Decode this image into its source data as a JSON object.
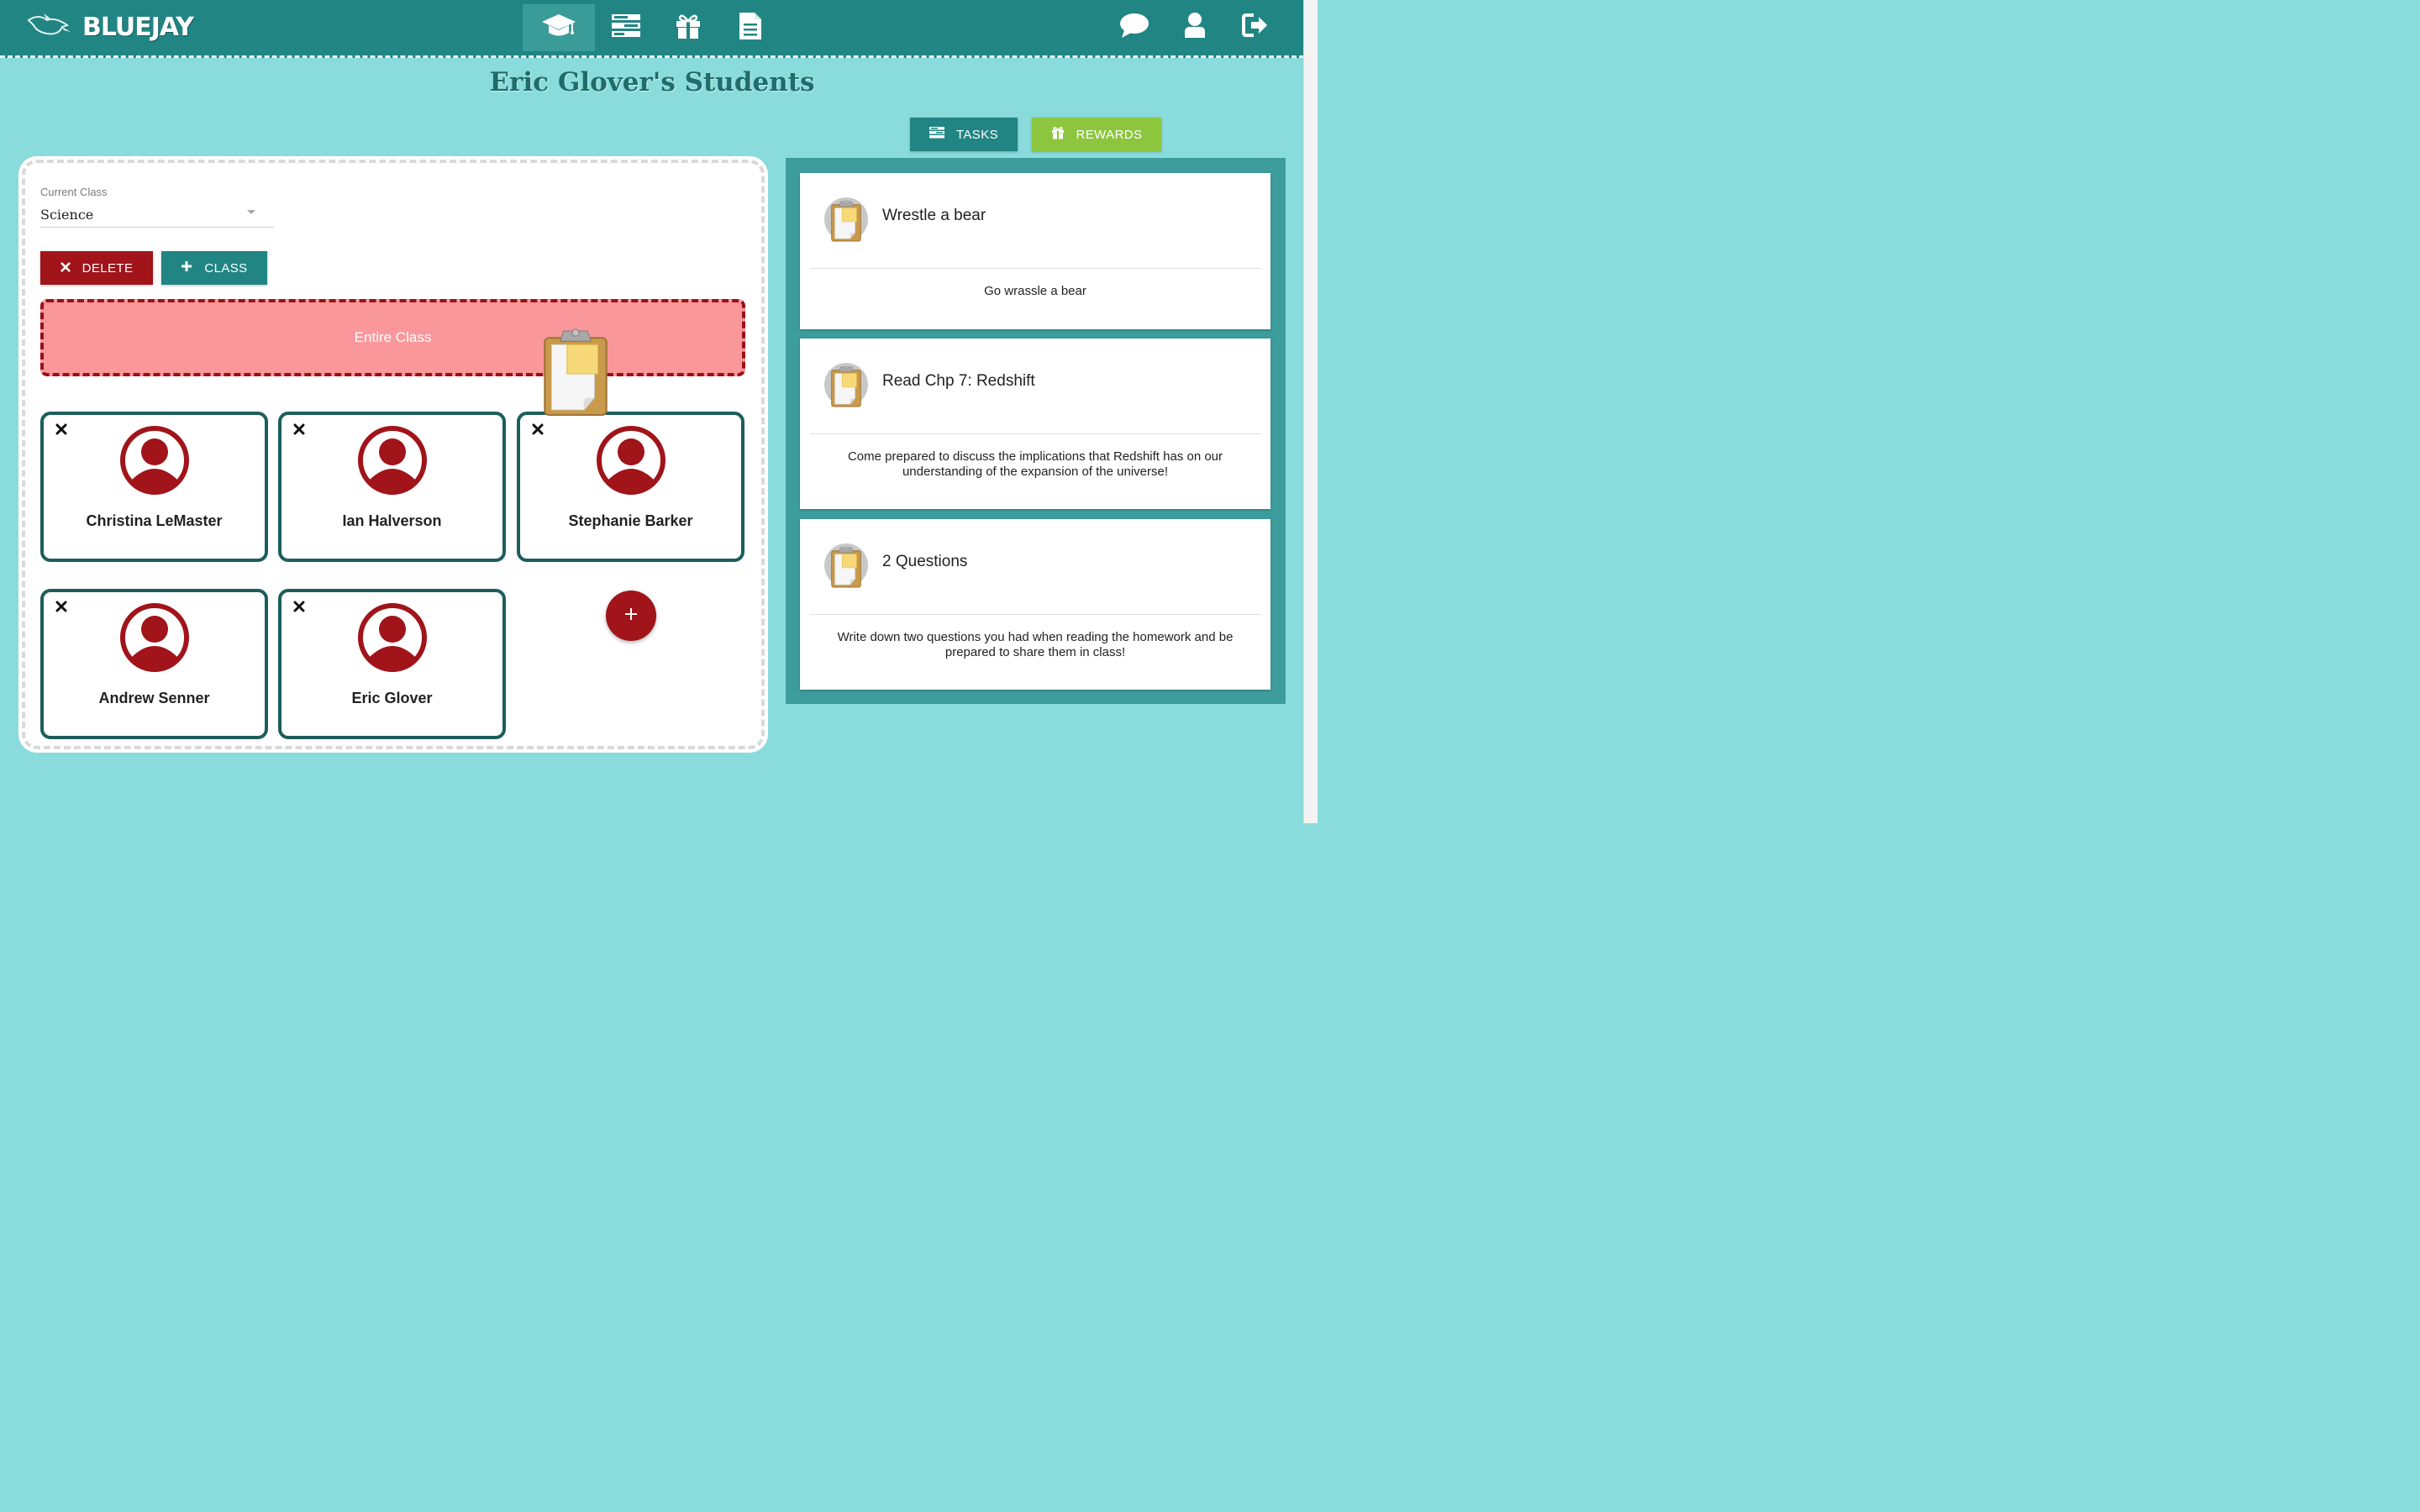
{
  "app": {
    "name": "BLUEJAY"
  },
  "nav": {
    "items": [
      {
        "name": "students",
        "icon": "graduation-cap-icon",
        "active": true
      },
      {
        "name": "tasks",
        "icon": "tasks-list-icon",
        "active": false
      },
      {
        "name": "rewards",
        "icon": "gift-icon",
        "active": false
      },
      {
        "name": "documents",
        "icon": "document-icon",
        "active": false
      }
    ],
    "right_icons": [
      "chat-icon",
      "user-icon",
      "logout-icon"
    ]
  },
  "page": {
    "title": "Eric Glover's Students"
  },
  "actions": {
    "tasks_label": "TASKS",
    "rewards_label": "REWARDS"
  },
  "class_selector": {
    "label": "Current Class",
    "value": "Science"
  },
  "class_buttons": {
    "delete_label": "DELETE",
    "add_class_label": "CLASS"
  },
  "dropzone": {
    "label": "Entire Class"
  },
  "students": [
    {
      "name": "Christina LeMaster"
    },
    {
      "name": "Ian Halverson"
    },
    {
      "name": "Stephanie Barker"
    },
    {
      "name": "Andrew Senner"
    },
    {
      "name": "Eric Glover"
    }
  ],
  "tasks": [
    {
      "title": "Wrestle a bear",
      "description": "Go wrassle a bear"
    },
    {
      "title": "Read Chp 7: Redshift",
      "description": "Come prepared to discuss the implications that Redshift has on our understanding of the expansion of the universe!"
    },
    {
      "title": "2 Questions",
      "description": "Write down two questions you had when reading the homework and be prepared to share them in class!"
    }
  ],
  "colors": {
    "teal": "#218583",
    "teal_dark": "#1c5e5c",
    "background": "#8adcdc",
    "red": "#a0141a",
    "green": "#8cc63f",
    "dropzone": "#f9979a"
  }
}
